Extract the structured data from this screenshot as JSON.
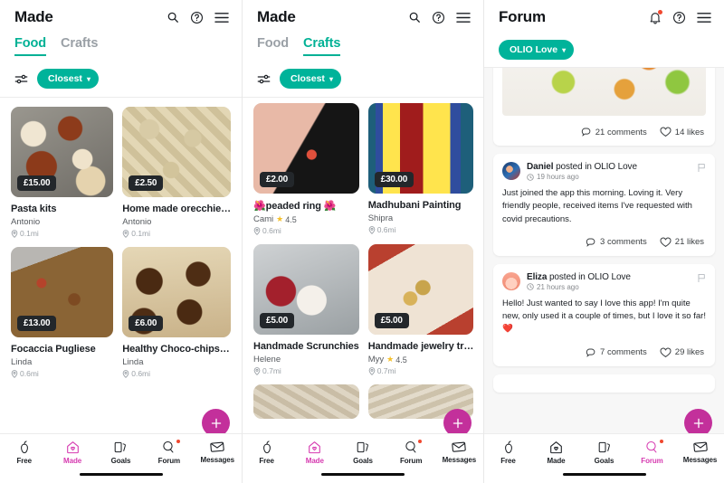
{
  "screens": [
    {
      "id": "made-food",
      "header": {
        "title": "Made",
        "icons": [
          "search-icon",
          "help-icon",
          "menu-icon"
        ]
      },
      "tabs": [
        {
          "label": "Food",
          "active": true
        },
        {
          "label": "Crafts",
          "active": false
        }
      ],
      "filter": {
        "icon": "filter-sliders-icon",
        "sort_label": "Closest",
        "chevron": "chevron-down-icon"
      },
      "listings": [
        {
          "title": "Pasta kits",
          "price": "£15.00",
          "seller": "Antonio",
          "rating": "",
          "distance": "0.1mi",
          "art": "ph-pasta"
        },
        {
          "title": "Home made orecchie…",
          "price": "£2.50",
          "seller": "Antonio",
          "rating": "",
          "distance": "0.1mi",
          "art": "ph-orecch"
        },
        {
          "title": "Focaccia Pugliese",
          "price": "£13.00",
          "seller": "Linda",
          "rating": "",
          "distance": "0.6mi",
          "art": "ph-focaccia"
        },
        {
          "title": "Healthy Choco-chips…",
          "price": "£6.00",
          "seller": "Linda",
          "rating": "",
          "distance": "0.6mi",
          "art": "ph-cookies"
        }
      ],
      "fab": "add-listing-button",
      "nav": [
        {
          "label": "Free",
          "icon": "apple-icon",
          "active": false,
          "badge": false
        },
        {
          "label": "Made",
          "icon": "house-icon",
          "active": true,
          "badge": false
        },
        {
          "label": "Goals",
          "icon": "cards-icon",
          "active": false,
          "badge": false
        },
        {
          "label": "Forum",
          "icon": "chat-icon",
          "active": false,
          "badge": true
        },
        {
          "label": "Messages",
          "icon": "envelope-icon",
          "active": false,
          "badge": false
        }
      ]
    },
    {
      "id": "made-crafts",
      "header": {
        "title": "Made",
        "icons": [
          "search-icon",
          "help-icon",
          "menu-icon"
        ]
      },
      "tabs": [
        {
          "label": "Food",
          "active": false
        },
        {
          "label": "Crafts",
          "active": true
        }
      ],
      "filter": {
        "icon": "filter-sliders-icon",
        "sort_label": "Closest",
        "chevron": "chevron-down-icon"
      },
      "listings": [
        {
          "title": "🌺peaded ring 🌺",
          "price": "£2.00",
          "seller": "Cami",
          "rating": "4.5",
          "distance": "0.6mi",
          "art": "ph-ring"
        },
        {
          "title": "Madhubani Painting",
          "price": "£30.00",
          "seller": "Shipra",
          "rating": "",
          "distance": "0.6mi",
          "art": "ph-madhubani"
        },
        {
          "title": "Handmade Scrunchies",
          "price": "£5.00",
          "seller": "Helene",
          "rating": "",
          "distance": "0.7mi",
          "art": "ph-scrunch"
        },
        {
          "title": "Handmade jewelry tr…",
          "price": "£5.00",
          "seller": "Myy",
          "rating": "4.5",
          "distance": "0.7mi",
          "art": "ph-jewel"
        }
      ],
      "fab": "add-listing-button",
      "nav": [
        {
          "label": "Free",
          "icon": "apple-icon",
          "active": false,
          "badge": false
        },
        {
          "label": "Made",
          "icon": "house-icon",
          "active": true,
          "badge": false
        },
        {
          "label": "Goals",
          "icon": "cards-icon",
          "active": false,
          "badge": false
        },
        {
          "label": "Forum",
          "icon": "chat-icon",
          "active": false,
          "badge": true
        },
        {
          "label": "Messages",
          "icon": "envelope-icon",
          "active": false,
          "badge": false
        }
      ]
    },
    {
      "id": "forum",
      "header": {
        "title": "Forum",
        "icons": [
          "bell-icon",
          "help-icon",
          "menu-icon"
        ]
      },
      "group_chip": {
        "label": "OLIO Love",
        "chevron": "chevron-down-icon"
      },
      "posts": [
        {
          "kind": "image",
          "art": "ph-hearts",
          "comments": "21 comments",
          "likes": "14 likes"
        },
        {
          "kind": "text",
          "author": "Daniel",
          "author_suffix": " posted in OLIO Love",
          "time": "19 hours ago",
          "avatar": "av-daniel",
          "text": "Just joined the app this morning. Loving it. Very friendly people, received items I've requested with covid precautions.",
          "comments": "3 comments",
          "likes": "21 likes"
        },
        {
          "kind": "text",
          "author": "Eliza",
          "author_suffix": " posted in OLIO Love",
          "time": "21 hours ago",
          "avatar": "av-eliza",
          "text": "Hello!  Just wanted to say I love this app!  I'm quite new, only used it a couple of times, but I love it so far! ❤️",
          "comments": "7 comments",
          "likes": "29 likes"
        }
      ],
      "fab": "add-post-button",
      "nav": [
        {
          "label": "Free",
          "icon": "apple-icon",
          "active": false,
          "badge": false
        },
        {
          "label": "Made",
          "icon": "house-icon",
          "active": false,
          "badge": false
        },
        {
          "label": "Goals",
          "icon": "cards-icon",
          "active": false,
          "badge": false
        },
        {
          "label": "Forum",
          "icon": "chat-icon",
          "active": true,
          "badge": true
        },
        {
          "label": "Messages",
          "icon": "envelope-icon",
          "active": false,
          "badge": false
        }
      ]
    }
  ],
  "colors": {
    "teal": "#00b39a",
    "pink": "#d63ab0",
    "fab_pink": "#c3309b",
    "price_bg": "#23272b",
    "muted": "#9aa0a6",
    "badge_red": "#f0482f"
  }
}
